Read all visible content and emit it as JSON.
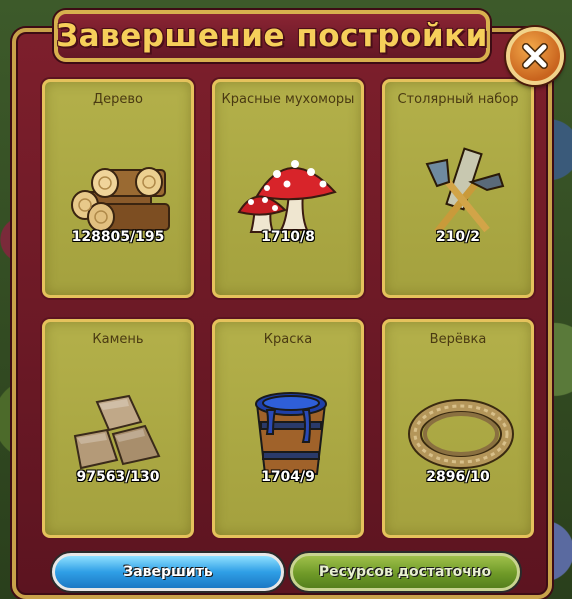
{
  "dialog": {
    "title": "Завершение постройки",
    "close_icon": "close-x-icon"
  },
  "resources": [
    {
      "name": "Дерево",
      "count": "128805/195",
      "icon": "wood-logs-icon"
    },
    {
      "name": "Красные мухоморы",
      "count": "1710/8",
      "icon": "red-mushrooms-icon"
    },
    {
      "name": "Столярный набор",
      "count": "210/2",
      "icon": "carpentry-tools-icon"
    },
    {
      "name": "Камень",
      "count": "97563/130",
      "icon": "stone-blocks-icon"
    },
    {
      "name": "Краска",
      "count": "1704/9",
      "icon": "paint-bucket-icon"
    },
    {
      "name": "Верёвка",
      "count": "2896/10",
      "icon": "rope-coil-icon"
    }
  ],
  "buttons": {
    "finish_label": "Завершить",
    "enough_label": "Ресурсов достаточно"
  },
  "colors": {
    "dialog_bg": "#7d1f2c",
    "frame_gold": "#c9a24a",
    "title_text": "#f6cf5a",
    "card_bg": "#b3b04a",
    "finish_button": "#2f9fe6",
    "enough_button": "#6f9a28"
  }
}
